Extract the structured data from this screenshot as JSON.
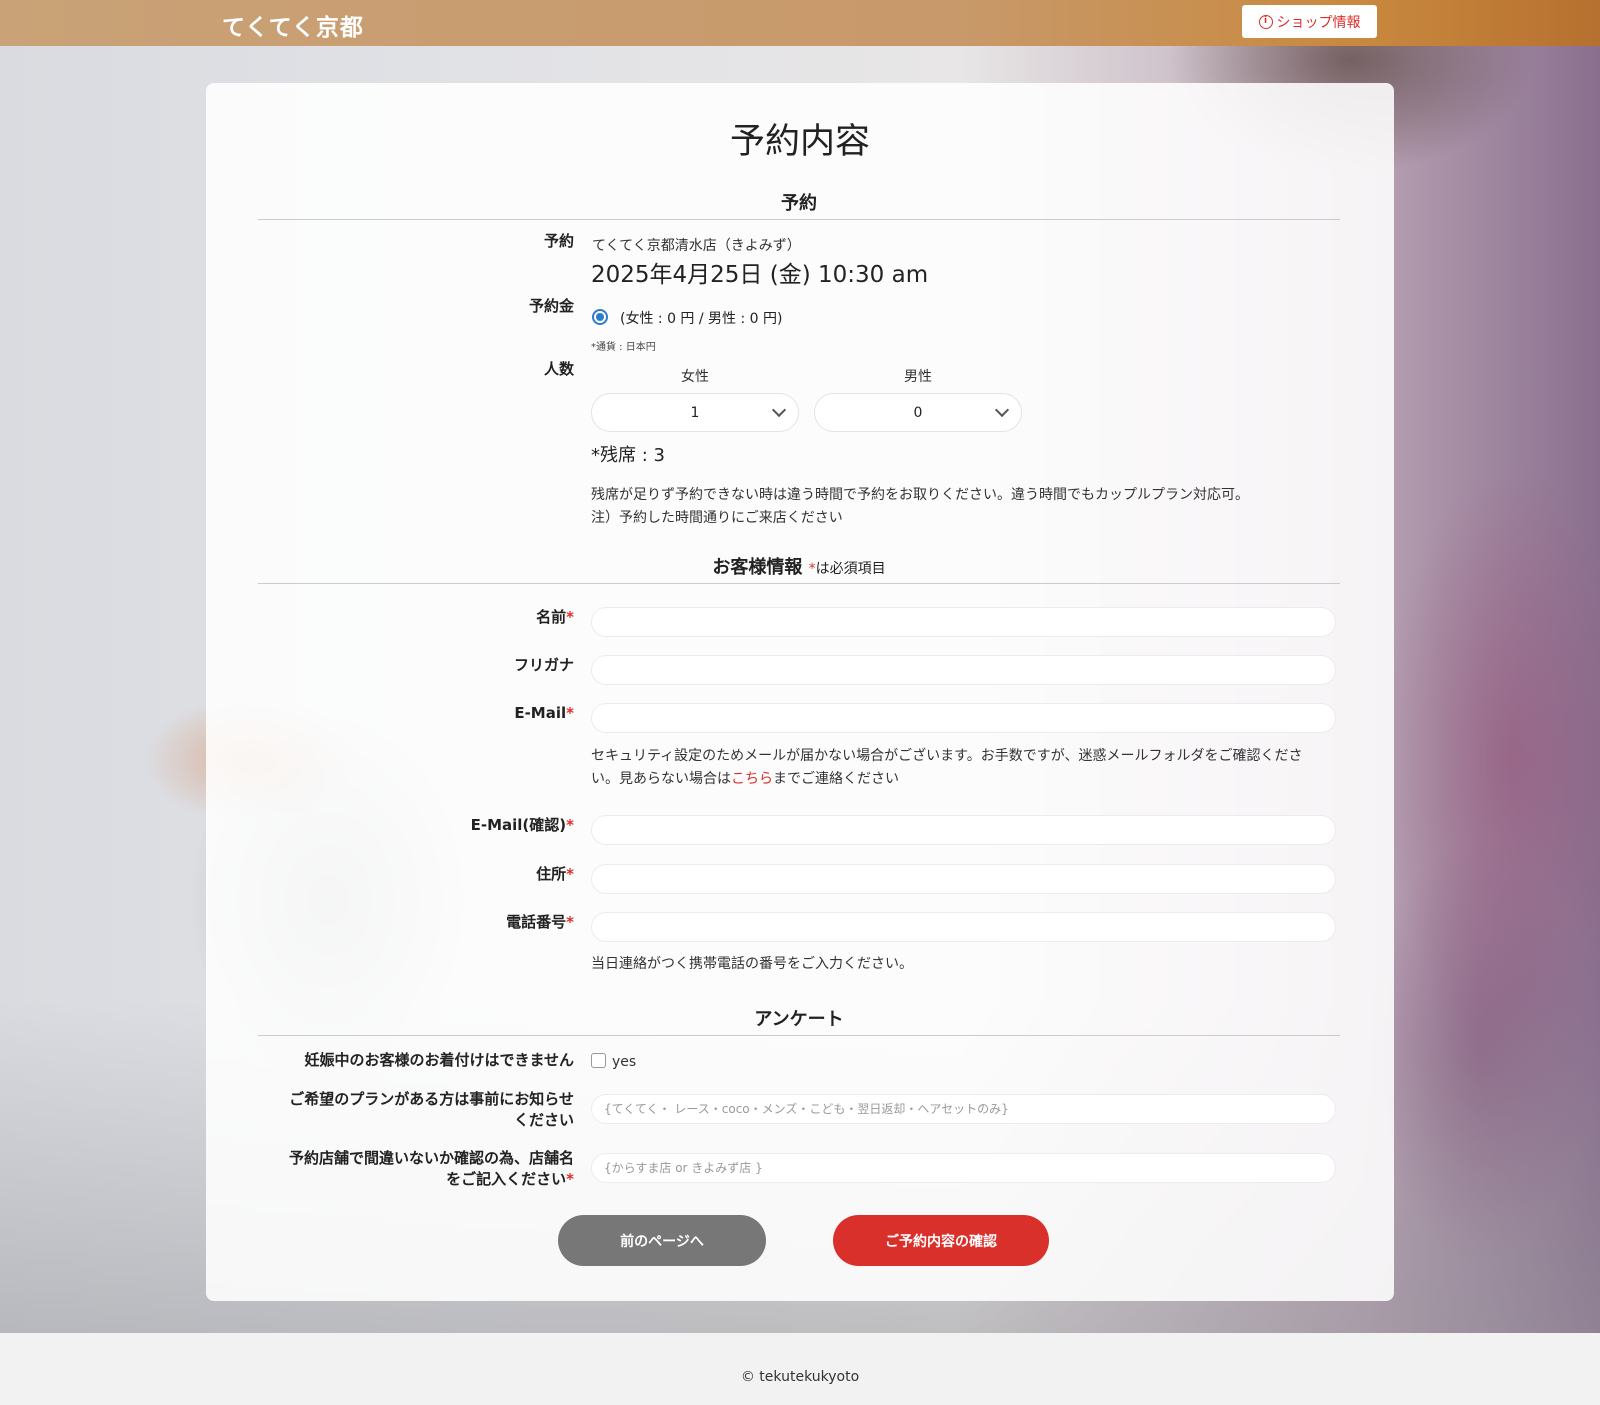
{
  "header": {
    "logo": "てくてく京都",
    "shop_info_label": "ショップ情報"
  },
  "title": "予約内容",
  "reservation": {
    "section_title": "予約",
    "label_reservation": "予約",
    "shop_name": "てくてく京都清水店（きよみず）",
    "datetime": "2025年4月25日 (金) 10:30 am",
    "label_deposit": "予約金",
    "deposit_option": "(女性 : 0 円 / 男性 : 0 円)",
    "currency_note": "*通貨 : 日本円",
    "label_people": "人数",
    "female_label": "女性",
    "male_label": "男性",
    "female_count": "1",
    "male_count": "0",
    "remaining": "*残席 : 3",
    "note_line1": "残席が足りず予約できない時は違う時間で予約をお取りください。違う時間でもカップルプラン対応可。",
    "note_line2": "注）予約した時間通りにご来店ください"
  },
  "customer": {
    "section_title": "お客様情報",
    "required_mark": "*",
    "required_note": "は必須項目",
    "name_label": "名前",
    "furigana_label": "フリガナ",
    "email_label": "E-Mail",
    "email_note_1": "セキュリティ設定のためメールが届かない場合がございます。お手数ですが、迷惑メールフォルダをご確認くださ",
    "email_note_2a": "い。見あらない場合は",
    "email_note_link": "こちら",
    "email_note_2b": "までご連絡ください",
    "email_confirm_label": "E-Mail(確認)",
    "address_label": "住所",
    "phone_label": "電話番号",
    "phone_note": "当日連絡がつく携帯電話の番号をご入力ください。"
  },
  "survey": {
    "section_title": "アンケート",
    "pregnancy_label": "妊娠中のお客様のお着付けはできません",
    "pregnancy_option": "yes",
    "plan_label_1": "ご希望のプランがある方は事前にお知らせ",
    "plan_label_2": "ください",
    "plan_placeholder": "{てくてく・ レース・coco・メンズ・こども・翌日返却・ヘアセットのみ}",
    "shop_label_1": "予約店舗で間違いないか確認の為、店舗名",
    "shop_label_2": "をご記入ください",
    "shop_placeholder": "{からすま店 or きよみず店 }"
  },
  "buttons": {
    "back": "前のページへ",
    "confirm": "ご予約内容の確認"
  },
  "footer": {
    "copyright": "© tekutekukyoto"
  },
  "colors": {
    "accent": "#d9302c",
    "header": "#c8996a",
    "back_button": "#777777"
  }
}
